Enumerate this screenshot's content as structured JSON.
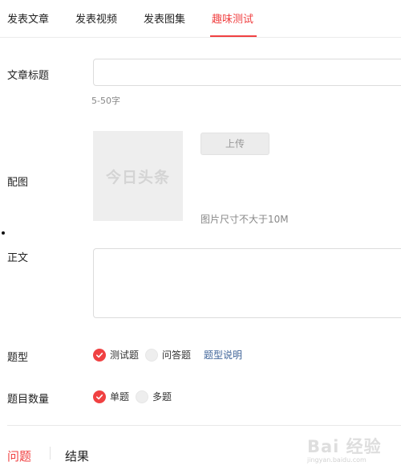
{
  "tabs": [
    {
      "label": "发表文章",
      "active": false
    },
    {
      "label": "发表视频",
      "active": false
    },
    {
      "label": "发表图集",
      "active": false
    },
    {
      "label": "趣味测试",
      "active": true
    }
  ],
  "form": {
    "title_label": "文章标题",
    "title_value": "",
    "title_hint": "5-50字",
    "image_label": "配图",
    "image_placeholder_text": "今日头条",
    "upload_label": "上传",
    "image_hint": "图片尺寸不大于10M",
    "body_label": "正文",
    "question_type_label": "题型",
    "question_type_options": [
      {
        "label": "测试题",
        "selected": true
      },
      {
        "label": "问答题",
        "selected": false
      }
    ],
    "question_type_help": "题型说明",
    "question_count_label": "题目数量",
    "question_count_options": [
      {
        "label": "单题",
        "selected": true
      },
      {
        "label": "多题",
        "selected": false
      }
    ]
  },
  "bottom_tabs": [
    {
      "label": "问题",
      "active": true
    },
    {
      "label": "结果",
      "active": false
    }
  ],
  "watermark": {
    "main": "Bai 经验",
    "sub": "jingyan.baidu.com"
  },
  "icons": {
    "radio_selected": "check-icon"
  },
  "colors": {
    "accent": "#f04142",
    "link": "#406599"
  }
}
